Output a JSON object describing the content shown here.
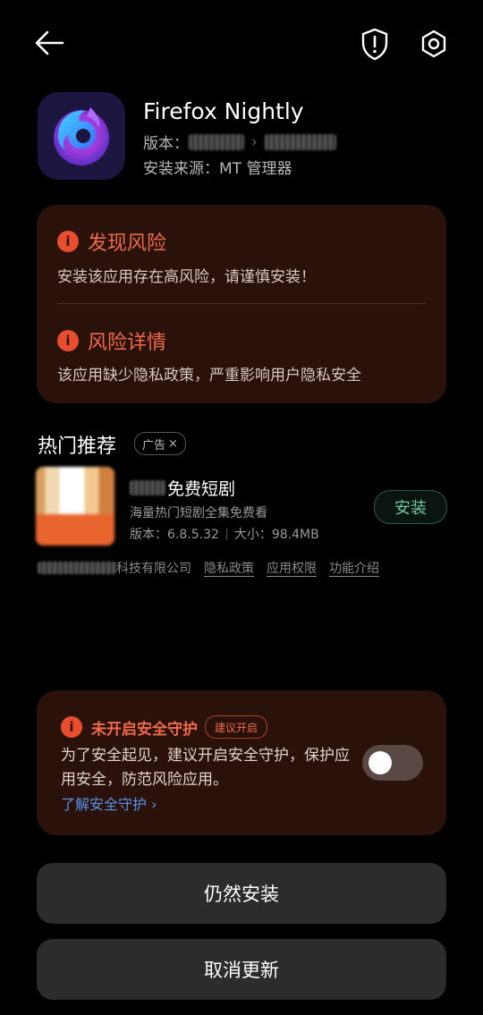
{
  "icons": {
    "back": "arrow-left-icon",
    "shield": "shield-exclamation-icon",
    "settings": "gear-icon",
    "warning": "info-warning-icon"
  },
  "app": {
    "name": "Firefox Nightly",
    "version_label": "版本：",
    "source_label": "安装来源：",
    "source_value": "MT 管理器"
  },
  "risk": {
    "found_title": "发现风险",
    "found_text": "安装该应用存在高风险，请谨慎安装！",
    "detail_title": "风险详情",
    "detail_text": "该应用缺少隐私政策，严重影响用户隐私安全"
  },
  "recommend": {
    "title": "热门推荐",
    "ad_tag": "广告",
    "ad_close": "×",
    "app_name_suffix": "免费短剧",
    "app_desc": "海量热门短剧全集免费看",
    "version": "版本：6.8.5.32",
    "size": "大小：98.4MB",
    "install": "安装",
    "company_suffix": "科技有限公司",
    "privacy": "隐私政策",
    "permissions": "应用权限",
    "features": "功能介绍"
  },
  "security": {
    "title": "未开启安全守护",
    "badge": "建议开启",
    "text": "为了安全起见，建议开启安全守护，保护应用安全，防范风险应用。",
    "link": "了解安全守护 ›",
    "toggle_on": false
  },
  "buttons": {
    "install_anyway": "仍然安装",
    "cancel_update": "取消更新"
  },
  "colors": {
    "warning": "#f06a4a",
    "card_bg": "#2a120b",
    "install_green": "#6cc79c",
    "link_blue": "#5a92e8"
  }
}
